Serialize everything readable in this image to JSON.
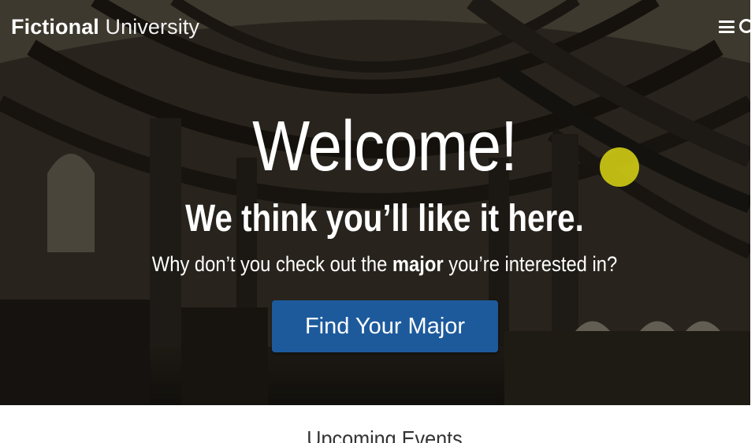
{
  "header": {
    "logo_bold": "Fictional",
    "logo_light": "University",
    "menu_icon": "hamburger-menu-icon",
    "search_icon": "search-icon"
  },
  "hero": {
    "title": "Welcome!",
    "subtitle": "We think you’ll like it here.",
    "lead_before": "Why don’t you check out the ",
    "lead_strong": "major",
    "lead_after": " you’re interested in?",
    "button_label": "Find Your Major"
  },
  "events": {
    "title": "Upcoming Events"
  },
  "colors": {
    "button": "#1d5a9c",
    "cursor_highlight": "#dcd714",
    "text": "#ffffff"
  }
}
